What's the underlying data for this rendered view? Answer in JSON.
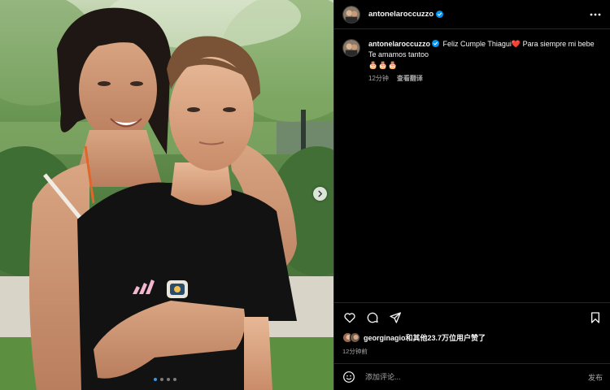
{
  "post": {
    "author": "antonelaroccuzzo",
    "author_verified": true,
    "caption": {
      "text_line1": "Feliz Cumple Thiagui",
      "heart": "❤️",
      "text_line1_tail": "Para siempre mi bebe",
      "text_line2": "Te amamos tantoo",
      "emoji_line": "🎂🎂🎂"
    },
    "caption_time": "12分钟",
    "translate_label": "查看翻译",
    "carousel": {
      "total": 4,
      "active_index": 0
    }
  },
  "likes": {
    "text_user": "georginagio",
    "text_rest": "和其他23.7万位用户赞了"
  },
  "timestamp": "12分钟前",
  "comment": {
    "placeholder": "添加评论...",
    "post_label": "发布"
  },
  "icons": {
    "more": "more-options-icon",
    "like": "heart-icon",
    "comment": "comment-icon",
    "share": "send-icon",
    "save": "bookmark-icon",
    "emoji": "emoji-icon",
    "next": "chevron-right-icon",
    "verified": "verified-badge-icon"
  },
  "colors": {
    "background": "#000000",
    "divider": "#262626",
    "text_primary": "#f5f5f5",
    "text_secondary": "#a8a8a8",
    "verified_blue": "#0095f6",
    "carousel_active": "#3797f0",
    "heart_red": "#ed1c24"
  }
}
